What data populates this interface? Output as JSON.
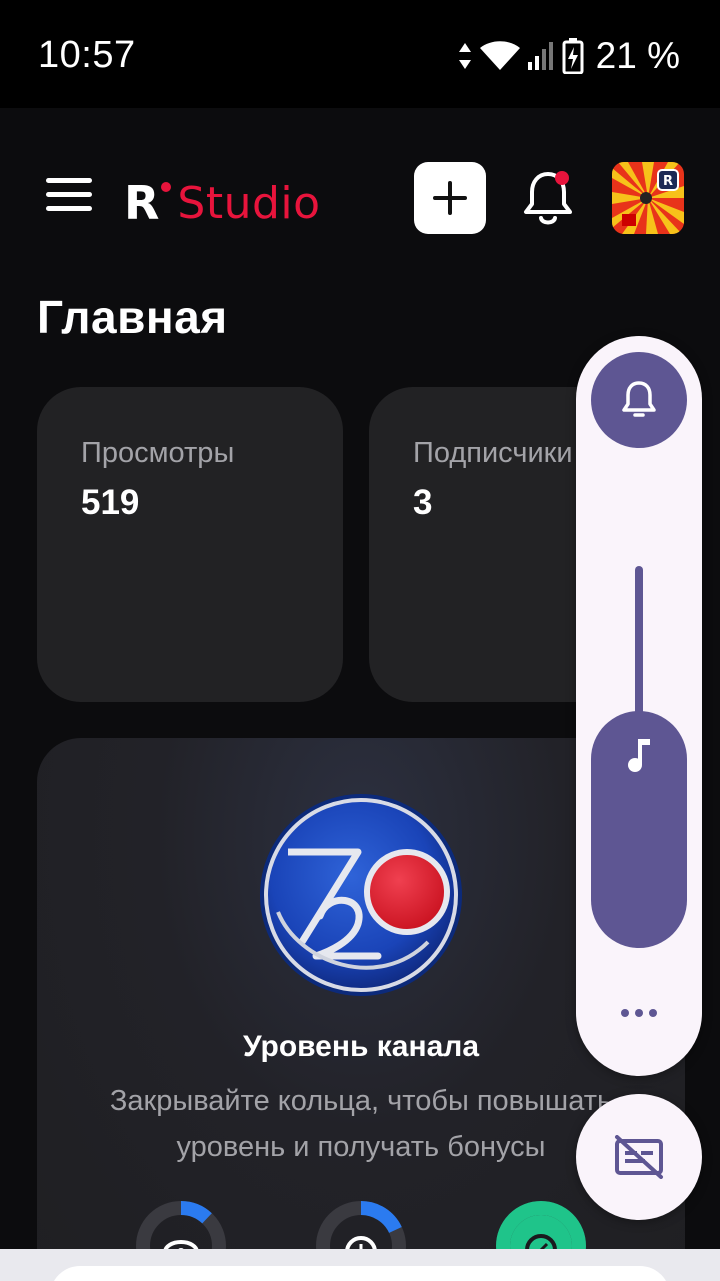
{
  "status_bar": {
    "time": "10:57",
    "battery_percent": "21 %"
  },
  "header": {
    "logo_letter": "R",
    "logo_text": "Studio",
    "brand_color": "#e8143c"
  },
  "page": {
    "title": "Главная"
  },
  "stats": [
    {
      "label": "Просмотры",
      "value": "519"
    },
    {
      "label": "Подписчики",
      "value": "3"
    }
  ],
  "level": {
    "title": "Уровень канала",
    "subtitle": "Закрывайте кольца, чтобы повышать уровень и получать бонусы",
    "rings": [
      {
        "icon": "eye-icon",
        "progress": 0.12,
        "color": "#2b7bf0"
      },
      {
        "icon": "clock-icon",
        "progress": 0.18,
        "color": "#2b7bf0"
      },
      {
        "icon": "percent-icon",
        "progress": 1.0,
        "color": "#1fc48a"
      }
    ]
  },
  "volume_panel": {
    "accent": "#5e5693",
    "level": 0.62
  }
}
